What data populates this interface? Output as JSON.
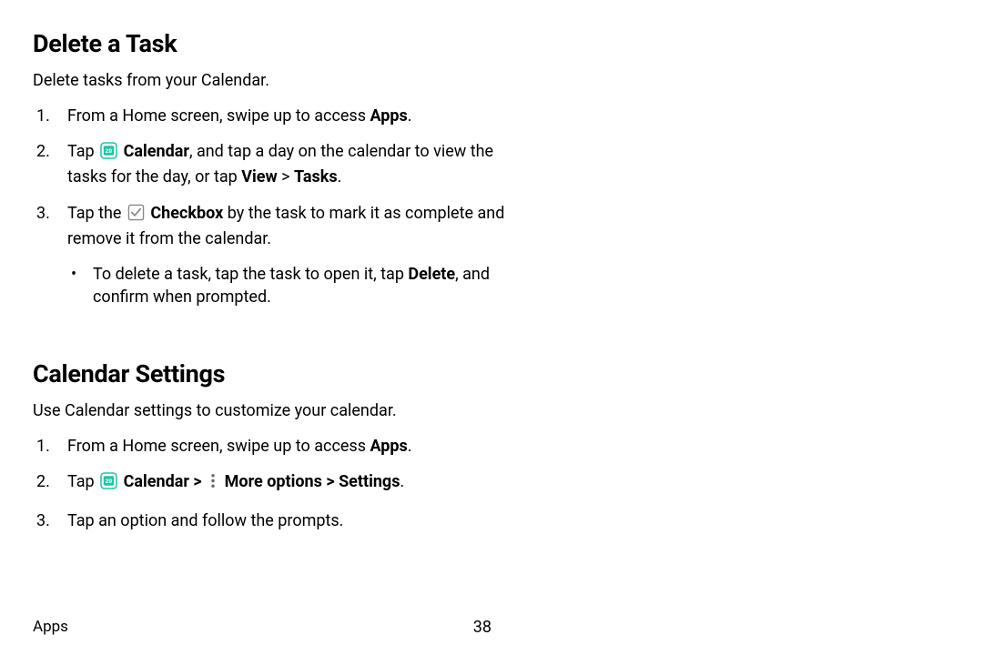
{
  "section1": {
    "title": "Delete a Task",
    "intro": "Delete tasks from your Calendar.",
    "step1_a": "From a Home screen, swipe up to access ",
    "step1_b": "Apps",
    "step1_c": ".",
    "step2_a": "Tap ",
    "step2_b": "Calendar",
    "step2_c": ", and tap a day on the calendar to view the tasks for the day, or tap ",
    "step2_d": "View",
    "step2_e": " > ",
    "step2_f": "Tasks",
    "step2_g": ".",
    "step3_a": "Tap the ",
    "step3_b": "Checkbox",
    "step3_c": " by the task to mark it as complete and remove it from the calendar.",
    "bullet_a": "To delete a task, tap the task to open it, tap ",
    "bullet_b": "Delete",
    "bullet_c": ", and confirm when prompted."
  },
  "section2": {
    "title": "Calendar Settings",
    "intro": "Use Calendar settings to customize your calendar.",
    "step1_a": "From a Home screen, swipe up to access ",
    "step1_b": "Apps",
    "step1_c": ".",
    "step2_a": "Tap ",
    "step2_b": "Calendar",
    "step2_c": " > ",
    "step2_d": "More options",
    "step2_e": " > ",
    "step2_f": "Settings",
    "step2_g": ".",
    "step3": "Tap an option and follow the prompts."
  },
  "footer": {
    "left": "Apps",
    "page": "38"
  },
  "colors": {
    "accent": "#1ec6a4"
  }
}
